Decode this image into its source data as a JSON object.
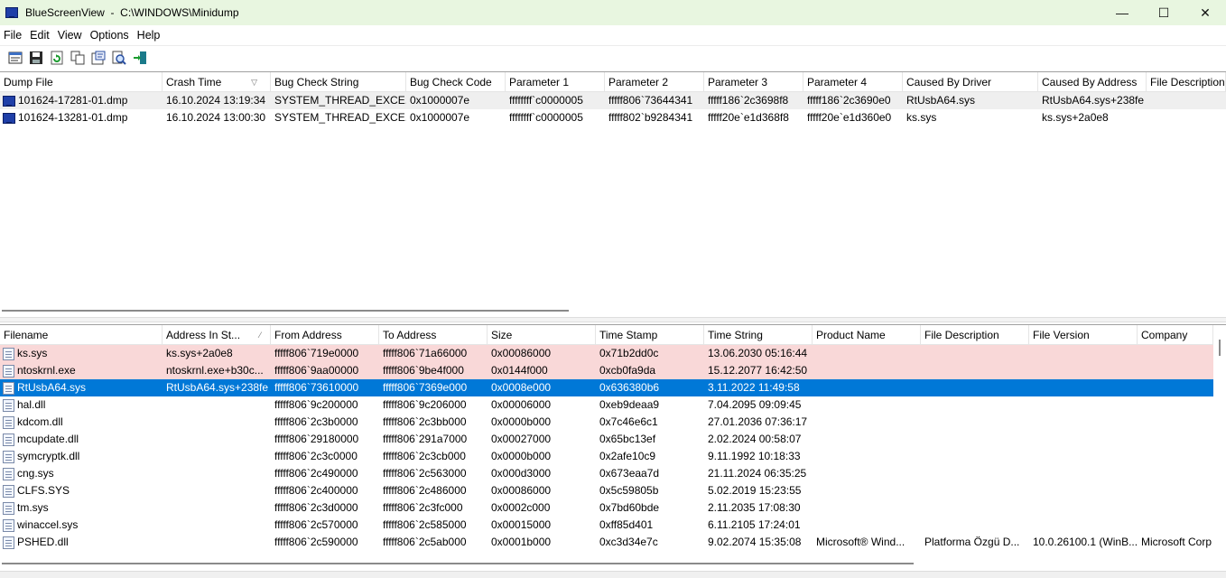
{
  "window": {
    "title": "BlueScreenView  -  C:\\WINDOWS\\Minidump",
    "minimize": "—",
    "maximize": "☐",
    "close": "✕"
  },
  "menu": [
    "File",
    "Edit",
    "View",
    "Options",
    "Help"
  ],
  "toolbar": [
    "properties-icon",
    "save-icon",
    "refresh-icon",
    "copy-icon",
    "html-report-icon",
    "find-icon",
    "exit-icon"
  ],
  "top_table": {
    "sorted_column": "Crash Time",
    "columns": [
      "Dump File",
      "Crash Time",
      "Bug Check String",
      "Bug Check Code",
      "Parameter 1",
      "Parameter 2",
      "Parameter 3",
      "Parameter 4",
      "Caused By Driver",
      "Caused By Address",
      "File Description"
    ],
    "rows": [
      [
        "101624-17281-01.dmp",
        "16.10.2024 13:19:34",
        "SYSTEM_THREAD_EXCE...",
        "0x1000007e",
        "ffffffff`c0000005",
        "fffff806`73644341",
        "fffff186`2c3698f8",
        "fffff186`2c3690e0",
        "RtUsbA64.sys",
        "RtUsbA64.sys+238fe",
        ""
      ],
      [
        "101624-13281-01.dmp",
        "16.10.2024 13:00:30",
        "SYSTEM_THREAD_EXCE...",
        "0x1000007e",
        "ffffffff`c0000005",
        "fffff802`b9284341",
        "fffff20e`e1d368f8",
        "fffff20e`e1d360e0",
        "ks.sys",
        "ks.sys+2a0e8",
        ""
      ]
    ]
  },
  "bottom_table": {
    "columns": [
      "Filename",
      "Address In St...",
      "From Address",
      "To Address",
      "Size",
      "Time Stamp",
      "Time String",
      "Product Name",
      "File Description",
      "File Version",
      "Company"
    ],
    "rows": [
      [
        "ks.sys",
        "ks.sys+2a0e8",
        "fffff806`719e0000",
        "fffff806`71a66000",
        "0x00086000",
        "0x71b2dd0c",
        "13.06.2030 05:16:44",
        "",
        "",
        "",
        ""
      ],
      [
        "ntoskrnl.exe",
        "ntoskrnl.exe+b30c...",
        "fffff806`9aa00000",
        "fffff806`9be4f000",
        "0x0144f000",
        "0xcb0fa9da",
        "15.12.2077 16:42:50",
        "",
        "",
        "",
        ""
      ],
      [
        "RtUsbA64.sys",
        "RtUsbA64.sys+238fe",
        "fffff806`73610000",
        "fffff806`7369e000",
        "0x0008e000",
        "0x636380b6",
        "3.11.2022 11:49:58",
        "",
        "",
        "",
        ""
      ],
      [
        "hal.dll",
        "",
        "fffff806`9c200000",
        "fffff806`9c206000",
        "0x00006000",
        "0xeb9deaa9",
        "7.04.2095 09:09:45",
        "",
        "",
        "",
        ""
      ],
      [
        "kdcom.dll",
        "",
        "fffff806`2c3b0000",
        "fffff806`2c3bb000",
        "0x0000b000",
        "0x7c46e6c1",
        "27.01.2036 07:36:17",
        "",
        "",
        "",
        ""
      ],
      [
        "mcupdate.dll",
        "",
        "fffff806`29180000",
        "fffff806`291a7000",
        "0x00027000",
        "0x65bc13ef",
        "2.02.2024 00:58:07",
        "",
        "",
        "",
        ""
      ],
      [
        "symcryptk.dll",
        "",
        "fffff806`2c3c0000",
        "fffff806`2c3cb000",
        "0x0000b000",
        "0x2afe10c9",
        "9.11.1992 10:18:33",
        "",
        "",
        "",
        ""
      ],
      [
        "cng.sys",
        "",
        "fffff806`2c490000",
        "fffff806`2c563000",
        "0x000d3000",
        "0x673eaa7d",
        "21.11.2024 06:35:25",
        "",
        "",
        "",
        ""
      ],
      [
        "CLFS.SYS",
        "",
        "fffff806`2c400000",
        "fffff806`2c486000",
        "0x00086000",
        "0x5c59805b",
        "5.02.2019 15:23:55",
        "",
        "",
        "",
        ""
      ],
      [
        "tm.sys",
        "",
        "fffff806`2c3d0000",
        "fffff806`2c3fc000",
        "0x0002c000",
        "0x7bd60bde",
        "2.11.2035 17:08:30",
        "",
        "",
        "",
        ""
      ],
      [
        "winaccel.sys",
        "",
        "fffff806`2c570000",
        "fffff806`2c585000",
        "0x00015000",
        "0xff85d401",
        "6.11.2105 17:24:01",
        "",
        "",
        "",
        ""
      ],
      [
        "PSHED.dll",
        "",
        "fffff806`2c590000",
        "fffff806`2c5ab000",
        "0x0001b000",
        "0xc3d34e7c",
        "9.02.2074 15:35:08",
        "Microsoft® Wind...",
        "Platforma Özgü D...",
        "10.0.26100.1 (WinB...",
        "Microsoft Corp"
      ]
    ],
    "row_states": [
      "pink",
      "pink",
      "selected",
      "",
      "",
      "",
      "",
      "",
      "",
      "",
      "",
      ""
    ]
  },
  "colors": {
    "titlebar": "#e8f6e0",
    "selection": "#0078d7",
    "highlight_row": "#f9d8d8",
    "dump_row": "#efefef"
  }
}
